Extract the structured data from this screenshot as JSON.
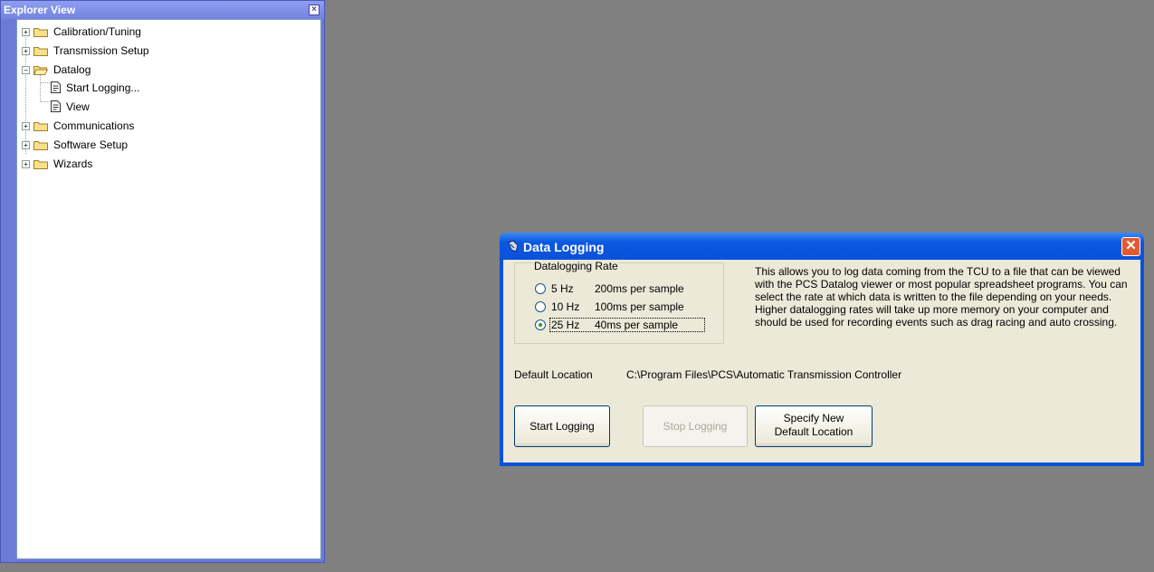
{
  "explorer": {
    "title": "Explorer View",
    "close_symbol": "×",
    "tree": [
      {
        "label": "Calibration/Tuning",
        "icon": "folder-icon",
        "expand": "+"
      },
      {
        "label": "Transmission Setup",
        "icon": "folder-icon",
        "expand": "+"
      },
      {
        "label": "Datalog",
        "icon": "folder-open-icon",
        "expand": "−"
      },
      {
        "label": "Start Logging...",
        "icon": "document-icon"
      },
      {
        "label": "View",
        "icon": "document-icon"
      },
      {
        "label": "Communications",
        "icon": "folder-icon",
        "expand": "+"
      },
      {
        "label": "Software Setup",
        "icon": "folder-icon",
        "expand": "+"
      },
      {
        "label": "Wizards",
        "icon": "folder-icon",
        "expand": "+"
      }
    ]
  },
  "dialog": {
    "title": "Data Logging",
    "close_symbol": "✕",
    "rate_group": {
      "legend": "Datalogging Rate",
      "options": [
        {
          "hz": "5 Hz",
          "ms": "200ms per sample",
          "selected": false
        },
        {
          "hz": "10 Hz",
          "ms": "100ms per sample",
          "selected": false
        },
        {
          "hz": "25 Hz",
          "ms": "40ms per sample",
          "selected": true
        }
      ]
    },
    "description": "This allows you to log data coming from the TCU to a file that can be viewed with the PCS Datalog viewer or most popular spreadsheet programs. You can select the rate at which data is written to the file depending on your needs. Higher datalogging rates will take up more memory on your computer and should be used for recording events such as drag racing and auto crossing.",
    "default_location_label": "Default Location",
    "default_location_path": "C:\\Program Files\\PCS\\Automatic Transmission Controller",
    "buttons": {
      "start": "Start Logging",
      "stop": "Stop Logging",
      "specify_line1": "Specify New",
      "specify_line2": "Default Location"
    }
  },
  "colors": {
    "desktop": "#808080",
    "xp_title_blue": "#0a51d9",
    "dialog_face": "#ece9d8",
    "close_red": "#e25a32"
  }
}
